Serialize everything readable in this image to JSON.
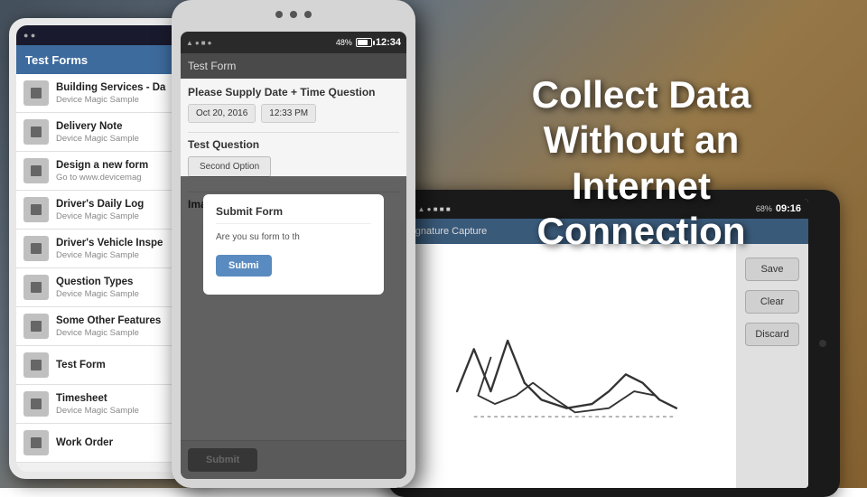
{
  "background": {
    "gradient_desc": "blurred construction crane background"
  },
  "hero": {
    "line1": "Collect Data",
    "line2": "Without an Internet",
    "line3": "Connection"
  },
  "phone1": {
    "title": "Test Forms",
    "items": [
      {
        "title": "Building Services - Da",
        "subtitle": "Device Magic Sample"
      },
      {
        "title": "Delivery Note",
        "subtitle": "Device Magic Sample"
      },
      {
        "title": "Design a new form",
        "subtitle": "Go to www.devicemag"
      },
      {
        "title": "Driver's Daily Log",
        "subtitle": "Device Magic Sample"
      },
      {
        "title": "Driver's Vehicle Inspe",
        "subtitle": "Device Magic Sample"
      },
      {
        "title": "Question Types",
        "subtitle": "Device Magic Sample"
      },
      {
        "title": "Some Other Features",
        "subtitle": "Device Magic Sample"
      },
      {
        "title": "Test Form",
        "subtitle": ""
      },
      {
        "title": "Timesheet",
        "subtitle": "Device Magic Sample"
      },
      {
        "title": "Work Order",
        "subtitle": ""
      }
    ]
  },
  "phone2": {
    "title": "Test Form",
    "statusbar": {
      "time": "12:34",
      "battery": "48%"
    },
    "form": {
      "section1": "Please Supply Date + Time Question",
      "date_value": "Oct 20, 2016",
      "time_value": "12:33 PM",
      "test_question_label": "Test Question",
      "second_option": "Second Option",
      "image_question_label": "Image Question"
    },
    "dialog": {
      "title": "Submit Form",
      "text": "Are you su form to th",
      "button": "Submi"
    },
    "submit_btn": "Submit"
  },
  "tablet": {
    "statusbar": {
      "time": "09:16",
      "battery": "68%"
    },
    "title": "Signature Capture",
    "buttons": {
      "save": "Save",
      "clear": "Clear",
      "discard": "Discard"
    }
  }
}
